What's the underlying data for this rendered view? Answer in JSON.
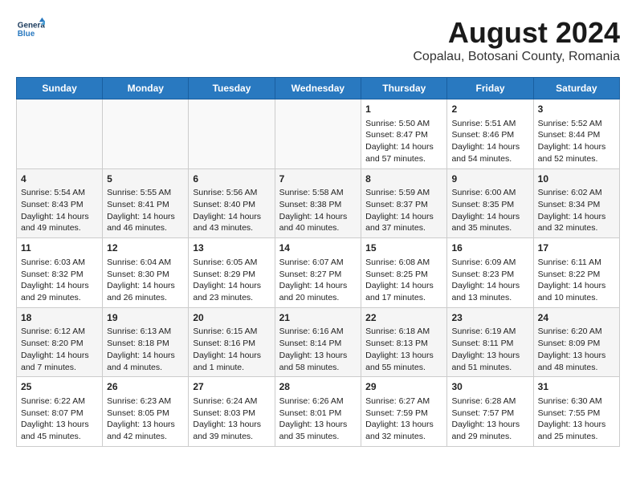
{
  "header": {
    "logo_general": "General",
    "logo_blue": "Blue",
    "title": "August 2024",
    "subtitle": "Copalau, Botosani County, Romania"
  },
  "days_of_week": [
    "Sunday",
    "Monday",
    "Tuesday",
    "Wednesday",
    "Thursday",
    "Friday",
    "Saturday"
  ],
  "weeks": [
    [
      {
        "day": "",
        "info": ""
      },
      {
        "day": "",
        "info": ""
      },
      {
        "day": "",
        "info": ""
      },
      {
        "day": "",
        "info": ""
      },
      {
        "day": "1",
        "info": "Sunrise: 5:50 AM\nSunset: 8:47 PM\nDaylight: 14 hours\nand 57 minutes."
      },
      {
        "day": "2",
        "info": "Sunrise: 5:51 AM\nSunset: 8:46 PM\nDaylight: 14 hours\nand 54 minutes."
      },
      {
        "day": "3",
        "info": "Sunrise: 5:52 AM\nSunset: 8:44 PM\nDaylight: 14 hours\nand 52 minutes."
      }
    ],
    [
      {
        "day": "4",
        "info": "Sunrise: 5:54 AM\nSunset: 8:43 PM\nDaylight: 14 hours\nand 49 minutes."
      },
      {
        "day": "5",
        "info": "Sunrise: 5:55 AM\nSunset: 8:41 PM\nDaylight: 14 hours\nand 46 minutes."
      },
      {
        "day": "6",
        "info": "Sunrise: 5:56 AM\nSunset: 8:40 PM\nDaylight: 14 hours\nand 43 minutes."
      },
      {
        "day": "7",
        "info": "Sunrise: 5:58 AM\nSunset: 8:38 PM\nDaylight: 14 hours\nand 40 minutes."
      },
      {
        "day": "8",
        "info": "Sunrise: 5:59 AM\nSunset: 8:37 PM\nDaylight: 14 hours\nand 37 minutes."
      },
      {
        "day": "9",
        "info": "Sunrise: 6:00 AM\nSunset: 8:35 PM\nDaylight: 14 hours\nand 35 minutes."
      },
      {
        "day": "10",
        "info": "Sunrise: 6:02 AM\nSunset: 8:34 PM\nDaylight: 14 hours\nand 32 minutes."
      }
    ],
    [
      {
        "day": "11",
        "info": "Sunrise: 6:03 AM\nSunset: 8:32 PM\nDaylight: 14 hours\nand 29 minutes."
      },
      {
        "day": "12",
        "info": "Sunrise: 6:04 AM\nSunset: 8:30 PM\nDaylight: 14 hours\nand 26 minutes."
      },
      {
        "day": "13",
        "info": "Sunrise: 6:05 AM\nSunset: 8:29 PM\nDaylight: 14 hours\nand 23 minutes."
      },
      {
        "day": "14",
        "info": "Sunrise: 6:07 AM\nSunset: 8:27 PM\nDaylight: 14 hours\nand 20 minutes."
      },
      {
        "day": "15",
        "info": "Sunrise: 6:08 AM\nSunset: 8:25 PM\nDaylight: 14 hours\nand 17 minutes."
      },
      {
        "day": "16",
        "info": "Sunrise: 6:09 AM\nSunset: 8:23 PM\nDaylight: 14 hours\nand 13 minutes."
      },
      {
        "day": "17",
        "info": "Sunrise: 6:11 AM\nSunset: 8:22 PM\nDaylight: 14 hours\nand 10 minutes."
      }
    ],
    [
      {
        "day": "18",
        "info": "Sunrise: 6:12 AM\nSunset: 8:20 PM\nDaylight: 14 hours\nand 7 minutes."
      },
      {
        "day": "19",
        "info": "Sunrise: 6:13 AM\nSunset: 8:18 PM\nDaylight: 14 hours\nand 4 minutes."
      },
      {
        "day": "20",
        "info": "Sunrise: 6:15 AM\nSunset: 8:16 PM\nDaylight: 14 hours\nand 1 minute."
      },
      {
        "day": "21",
        "info": "Sunrise: 6:16 AM\nSunset: 8:14 PM\nDaylight: 13 hours\nand 58 minutes."
      },
      {
        "day": "22",
        "info": "Sunrise: 6:18 AM\nSunset: 8:13 PM\nDaylight: 13 hours\nand 55 minutes."
      },
      {
        "day": "23",
        "info": "Sunrise: 6:19 AM\nSunset: 8:11 PM\nDaylight: 13 hours\nand 51 minutes."
      },
      {
        "day": "24",
        "info": "Sunrise: 6:20 AM\nSunset: 8:09 PM\nDaylight: 13 hours\nand 48 minutes."
      }
    ],
    [
      {
        "day": "25",
        "info": "Sunrise: 6:22 AM\nSunset: 8:07 PM\nDaylight: 13 hours\nand 45 minutes."
      },
      {
        "day": "26",
        "info": "Sunrise: 6:23 AM\nSunset: 8:05 PM\nDaylight: 13 hours\nand 42 minutes."
      },
      {
        "day": "27",
        "info": "Sunrise: 6:24 AM\nSunset: 8:03 PM\nDaylight: 13 hours\nand 39 minutes."
      },
      {
        "day": "28",
        "info": "Sunrise: 6:26 AM\nSunset: 8:01 PM\nDaylight: 13 hours\nand 35 minutes."
      },
      {
        "day": "29",
        "info": "Sunrise: 6:27 AM\nSunset: 7:59 PM\nDaylight: 13 hours\nand 32 minutes."
      },
      {
        "day": "30",
        "info": "Sunrise: 6:28 AM\nSunset: 7:57 PM\nDaylight: 13 hours\nand 29 minutes."
      },
      {
        "day": "31",
        "info": "Sunrise: 6:30 AM\nSunset: 7:55 PM\nDaylight: 13 hours\nand 25 minutes."
      }
    ]
  ]
}
